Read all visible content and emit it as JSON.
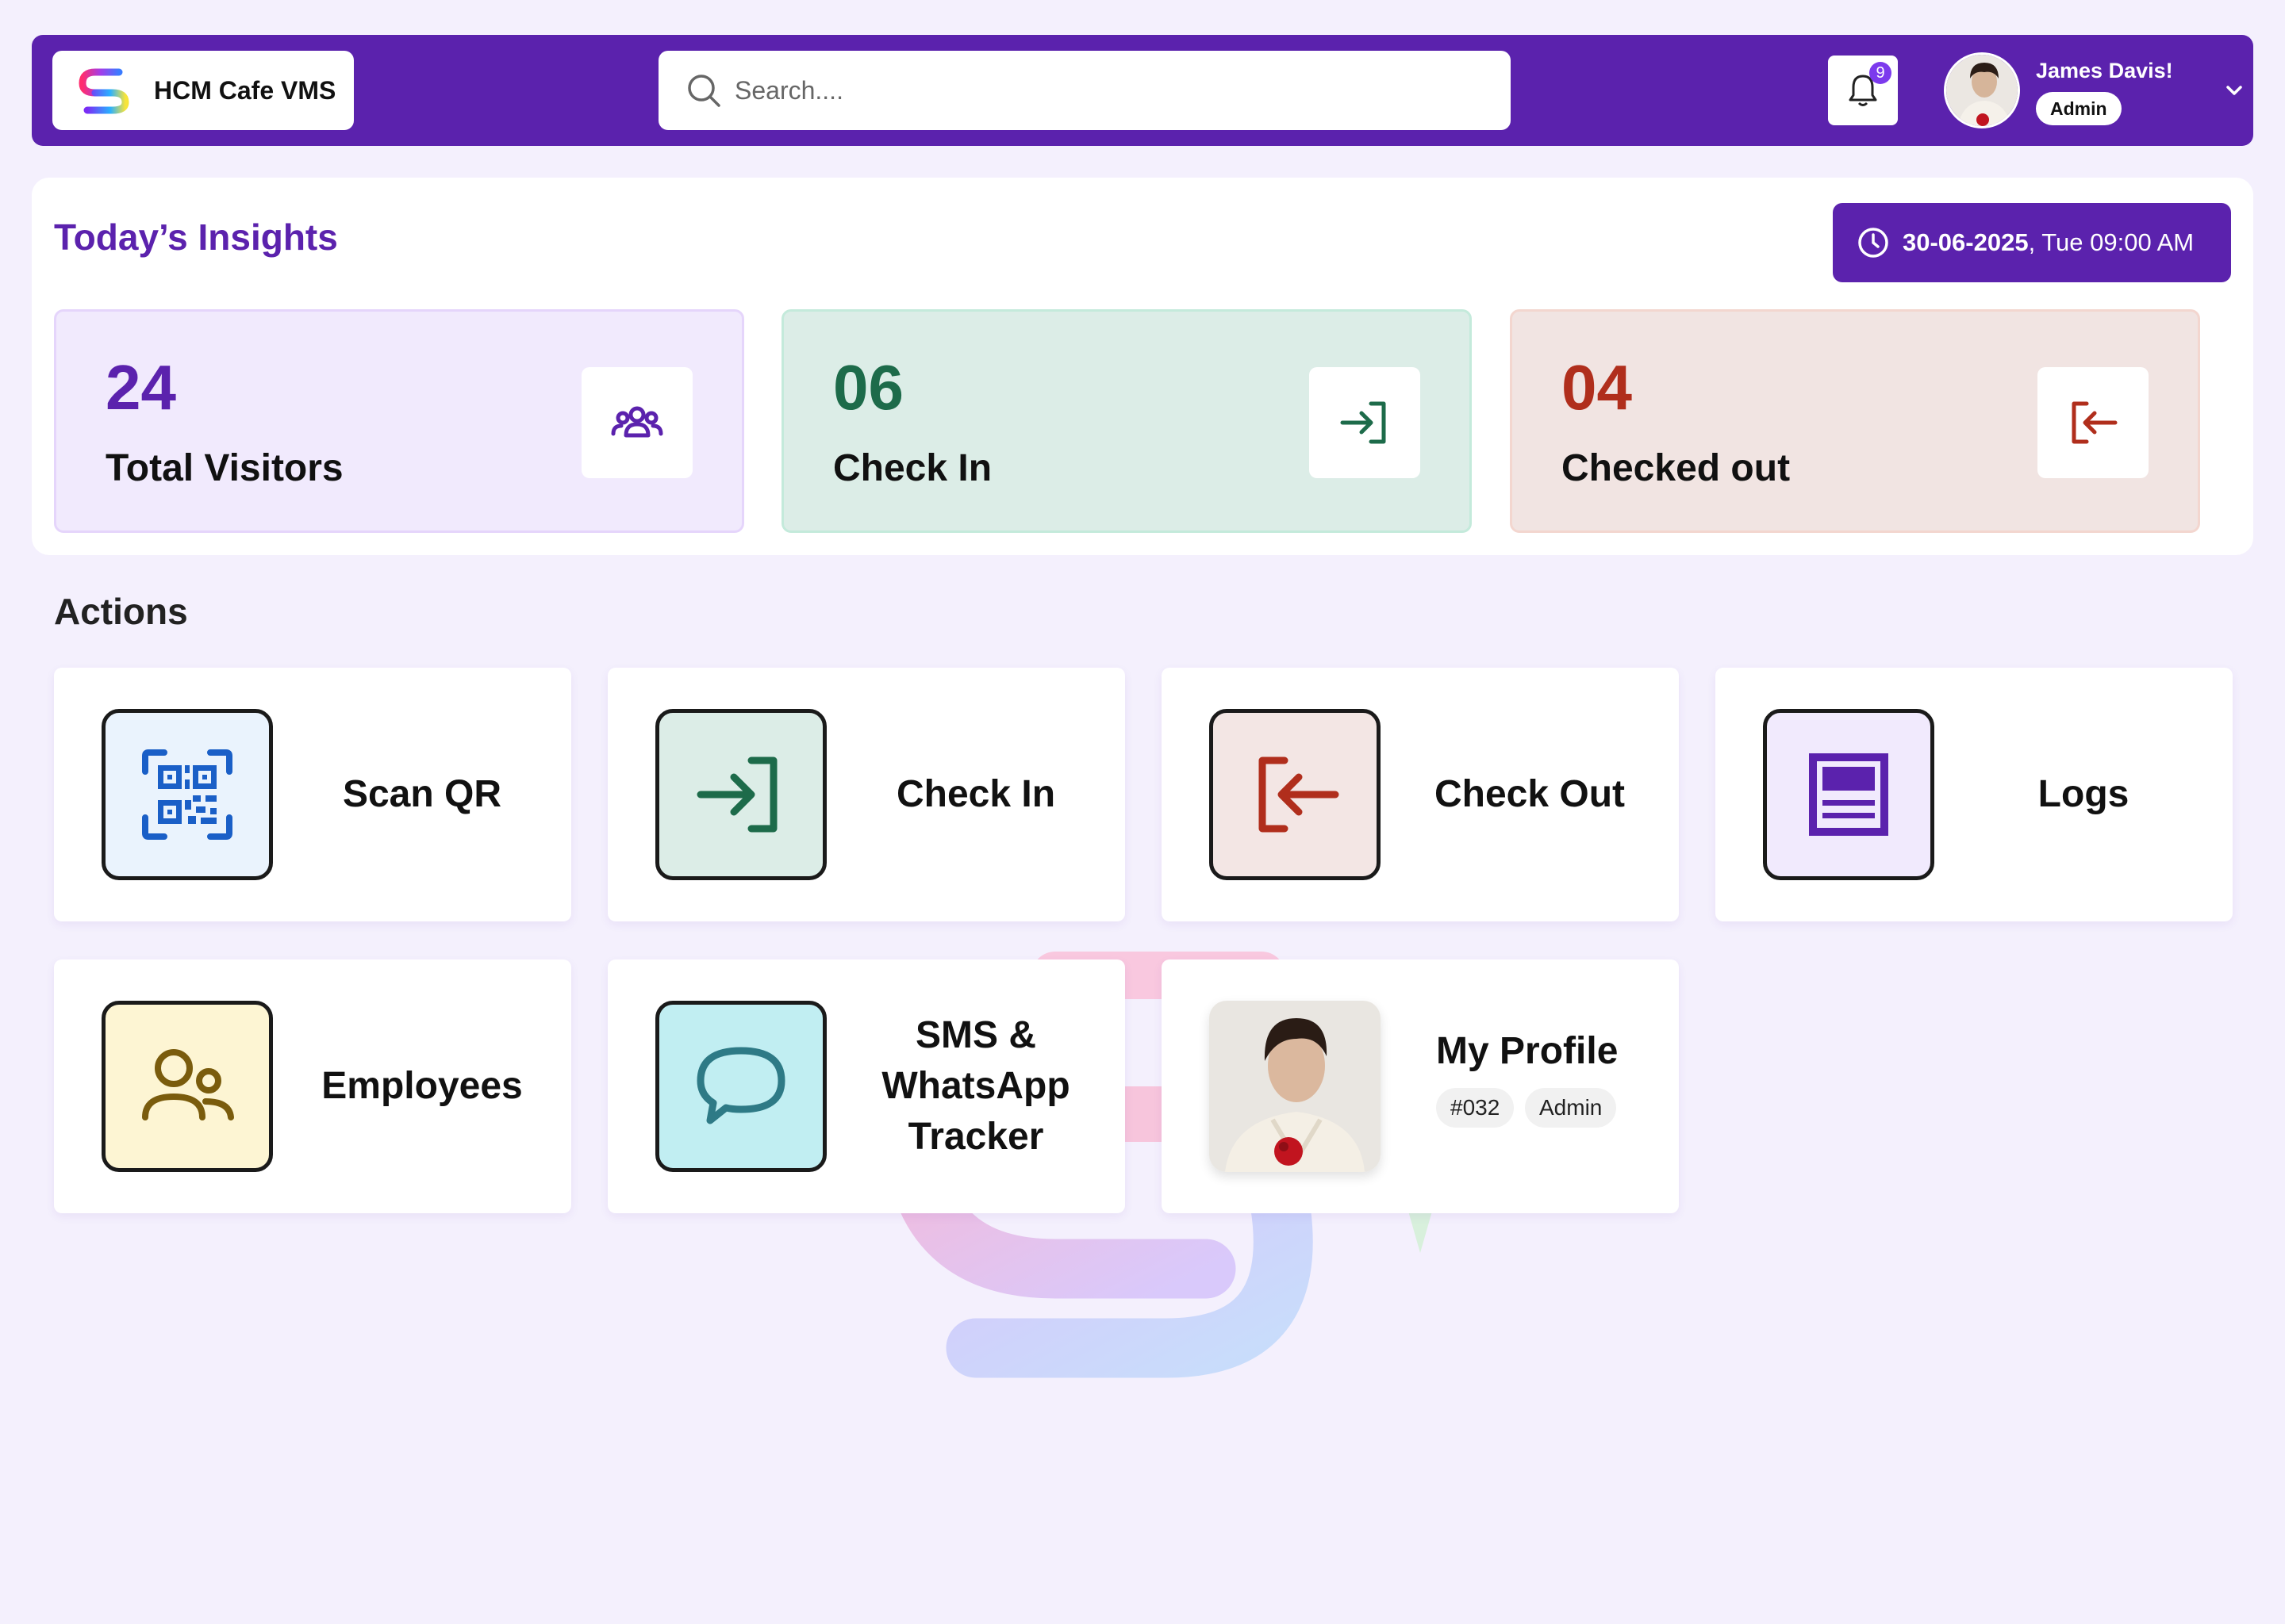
{
  "header": {
    "app_name": "HCM Cafe VMS",
    "search_placeholder": "Search....",
    "notification_count": "9",
    "user_name": "James Davis!",
    "user_role": "Admin",
    "brand_color": "#5b22ad"
  },
  "insights": {
    "title": "Today’s Insights",
    "date": "30-06-2025",
    "time": ", Tue 09:00 AM",
    "stats": [
      {
        "value": "24",
        "label": "Total Visitors",
        "icon": "users-group-icon",
        "color": "#5b22ad"
      },
      {
        "value": "06",
        "label": "Check In",
        "icon": "login-icon",
        "color": "#1d6b4a"
      },
      {
        "value": "04",
        "label": "Checked out",
        "icon": "logout-icon",
        "color": "#b02e1c"
      }
    ]
  },
  "actions": {
    "title": "Actions",
    "items": [
      {
        "label": "Scan QR",
        "icon": "qr-code-icon"
      },
      {
        "label": "Check In",
        "icon": "login-icon"
      },
      {
        "label": "Check Out",
        "icon": "logout-icon"
      },
      {
        "label": "Logs",
        "icon": "logs-document-icon"
      },
      {
        "label": "Employees",
        "icon": "employees-icon"
      },
      {
        "label": "SMS & WhatsApp Tracker",
        "icon": "chat-bubble-icon"
      }
    ],
    "profile": {
      "label": "My Profile",
      "id": "#032",
      "role": "Admin"
    }
  }
}
